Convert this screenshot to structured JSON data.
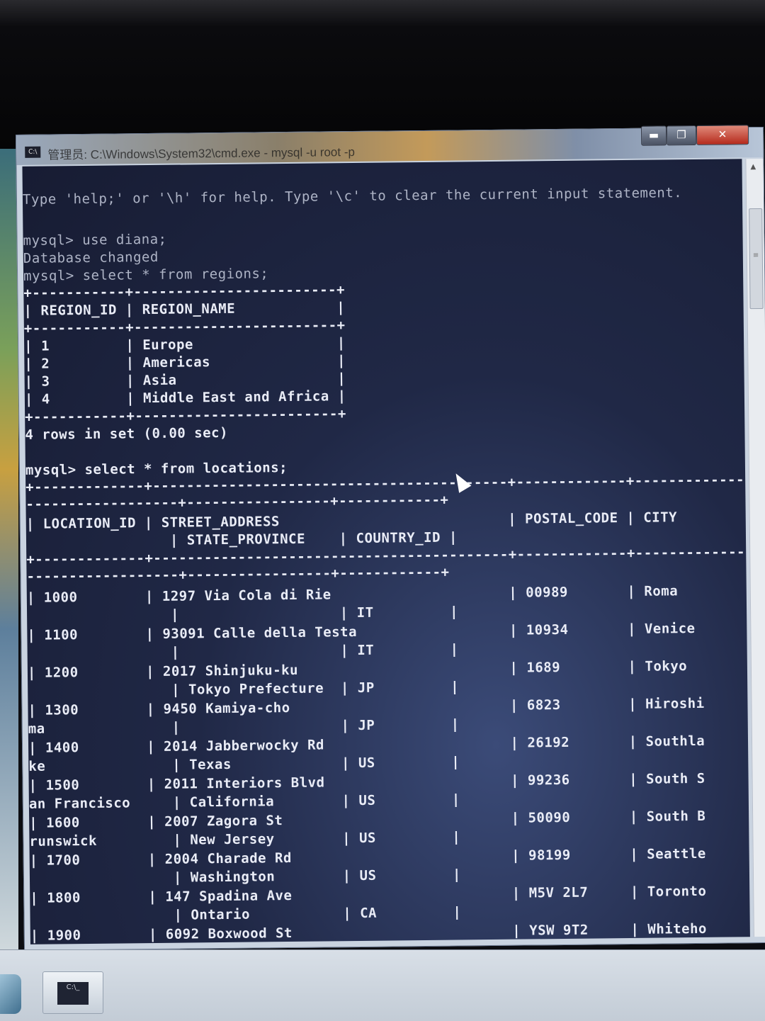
{
  "window": {
    "title": "管理员: C:\\Windows\\System32\\cmd.exe - mysql -u root -p",
    "app_icon_text": "C:\\",
    "min_glyph": "▬",
    "max_glyph": "❐",
    "close_glyph": "✕"
  },
  "console": {
    "help_line": "Type 'help;' or '\\h' for help. Type '\\c' to clear the current input statement.",
    "lines": {
      "use_cmd": "mysql> use diana;",
      "db_changed": "Database changed",
      "select_regions": "mysql> select * from regions;",
      "r_sep1": "+-----------+------------------------+",
      "r_header": "| REGION_ID | REGION_NAME            |",
      "r_sep2": "+-----------+------------------------+",
      "r_row1": "| 1         | Europe                 |",
      "r_row2": "| 2         | Americas               |",
      "r_row3": "| 3         | Asia                   |",
      "r_row4": "| 4         | Middle East and Africa |",
      "r_sep3": "+-----------+------------------------+",
      "r_count": "4 rows in set (0.00 sec)",
      "select_locations": "mysql> select * from locations;",
      "l_sep1": "+-------------+------------------------------------------+-------------+--------------------",
      "l_sep1b": "------------------+-----------------+------------+",
      "l_header1": "| LOCATION_ID | STREET_ADDRESS                           | POSTAL_CODE | CITY",
      "l_header2": "                 | STATE_PROVINCE    | COUNTRY_ID |",
      "l_sep2": "+-------------+------------------------------------------+-------------+--------------------",
      "l_sep2b": "------------------+-----------------+------------+",
      "l_1000a": "| 1000        | 1297 Via Cola di Rie                     | 00989       | Roma",
      "l_1000b": "                 |                   | IT         |",
      "l_1100a": "| 1100        | 93091 Calle della Testa                  | 10934       | Venice",
      "l_1100b": "                 |                   | IT         |",
      "l_1200a": "| 1200        | 2017 Shinjuku-ku                         | 1689        | Tokyo",
      "l_1200b": "                 | Tokyo Prefecture  | JP         |",
      "l_1300a": "| 1300        | 9450 Kamiya-cho                          | 6823        | Hiroshi",
      "l_1300b": "ma               |                   | JP         |",
      "l_1400a": "| 1400        | 2014 Jabberwocky Rd                      | 26192       | Southla",
      "l_1400b": "ke               | Texas             | US         |",
      "l_1500a": "| 1500        | 2011 Interiors Blvd                      | 99236       | South S",
      "l_1500b": "an Francisco     | California        | US         |",
      "l_1600a": "| 1600        | 2007 Zagora St                           | 50090       | South B",
      "l_1600b": "runswick         | New Jersey        | US         |",
      "l_1700a": "| 1700        | 2004 Charade Rd                          | 98199       | Seattle",
      "l_1700b": "                 | Washington        | US         |",
      "l_1800a": "| 1800        | 147 Spadina Ave                          | M5V 2L7     | Toronto",
      "l_1800b": "                 | Ontario           | CA         |",
      "l_1900a": "| 1900        | 6092 Boxwood St                          | YSW 9T2     | Whiteho"
    }
  },
  "taskbar": {
    "task_icon_text": "C:\\_"
  }
}
